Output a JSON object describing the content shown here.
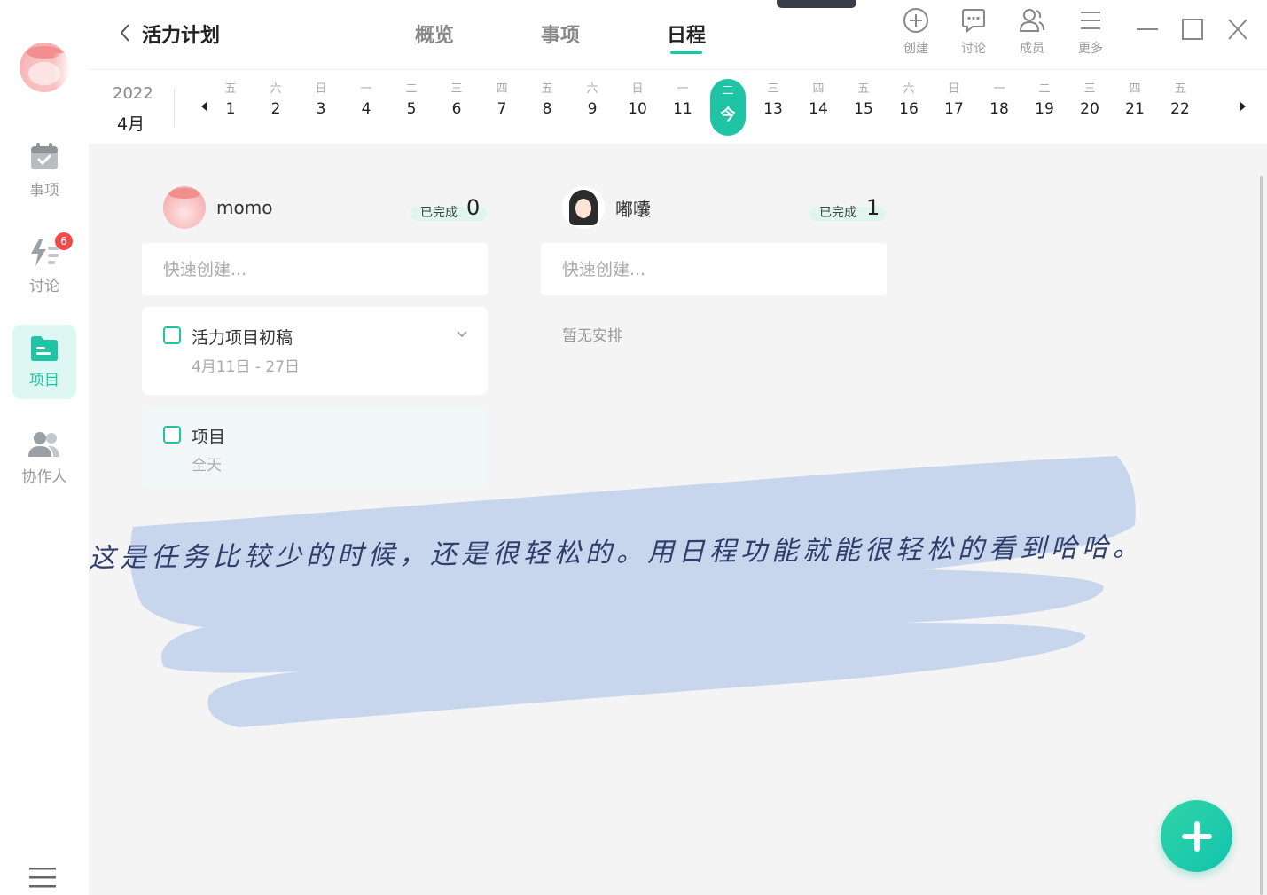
{
  "sidebar": {
    "nav": [
      {
        "id": "tasks",
        "label": "事项",
        "icon": "calendar-check-icon"
      },
      {
        "id": "discuss",
        "label": "讨论",
        "icon": "lightning-list-icon",
        "badge": "6"
      },
      {
        "id": "projects",
        "label": "项目",
        "icon": "folder-icon",
        "active": true
      },
      {
        "id": "collaborators",
        "label": "协作人",
        "icon": "people-icon"
      }
    ]
  },
  "header": {
    "project_title": "活力计划",
    "tabs": [
      {
        "label": "概览"
      },
      {
        "label": "事项"
      },
      {
        "label": "日程",
        "active": true
      }
    ],
    "tools": [
      {
        "label": "创建",
        "icon": "plus-circle-icon"
      },
      {
        "label": "讨论",
        "icon": "chat-bubble-icon"
      },
      {
        "label": "成员",
        "icon": "members-icon"
      },
      {
        "label": "更多",
        "icon": "hamburger-icon"
      }
    ]
  },
  "datebar": {
    "year": "2022",
    "month": "4月",
    "days": [
      {
        "wd": "五",
        "d": "1"
      },
      {
        "wd": "六",
        "d": "2"
      },
      {
        "wd": "日",
        "d": "3"
      },
      {
        "wd": "一",
        "d": "4"
      },
      {
        "wd": "二",
        "d": "5"
      },
      {
        "wd": "三",
        "d": "6"
      },
      {
        "wd": "四",
        "d": "7"
      },
      {
        "wd": "五",
        "d": "8"
      },
      {
        "wd": "六",
        "d": "9"
      },
      {
        "wd": "日",
        "d": "10"
      },
      {
        "wd": "一",
        "d": "11"
      },
      {
        "wd": "二",
        "d": "今",
        "today": true
      },
      {
        "wd": "三",
        "d": "13"
      },
      {
        "wd": "四",
        "d": "14"
      },
      {
        "wd": "五",
        "d": "15"
      },
      {
        "wd": "六",
        "d": "16"
      },
      {
        "wd": "日",
        "d": "17"
      },
      {
        "wd": "一",
        "d": "18"
      },
      {
        "wd": "二",
        "d": "19"
      },
      {
        "wd": "三",
        "d": "20"
      },
      {
        "wd": "四",
        "d": "21"
      },
      {
        "wd": "五",
        "d": "22"
      }
    ]
  },
  "columns": [
    {
      "user": "momo",
      "done_label": "已完成",
      "done_count": "0",
      "quick_placeholder": "快速创建...",
      "tasks": [
        {
          "name": "活力项目初稿",
          "sub": "4月11日 - 27日"
        },
        {
          "name": "项目",
          "sub": "全天"
        }
      ]
    },
    {
      "user": "嘟囔",
      "done_label": "已完成",
      "done_count": "1",
      "quick_placeholder": "快速创建...",
      "empty_text": "暂无安排"
    }
  ],
  "annotation": {
    "text": "这是任务比较少的时候，还是很轻松的。用日程功能就能很轻松的看到哈哈。"
  },
  "colors": {
    "accent": "#1ec4a4",
    "badge": "#f04b4b",
    "brush": "#c3d3ec",
    "annotation_text": "#2f3e6b"
  }
}
